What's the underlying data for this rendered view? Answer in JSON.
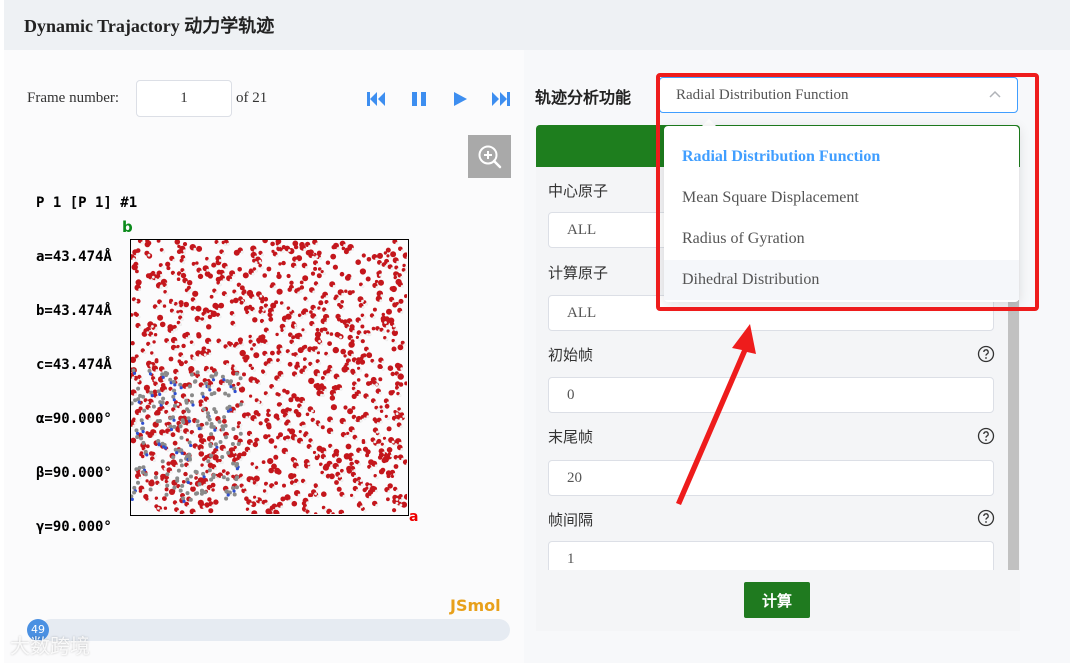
{
  "header": {
    "title": "Dynamic Trajactory 动力学轨迹"
  },
  "viewer": {
    "frame_label": "Frame number:",
    "frame_value": "1",
    "frame_of": "of 21",
    "controls": [
      "skip-back-icon",
      "pause-icon",
      "play-icon",
      "skip-forward-icon"
    ],
    "unit_cell_lines": [
      "P 1 [P 1] #1",
      "a=43.474Å",
      "b=43.474Å",
      "c=43.474Å",
      "α=90.000°",
      "β=90.000°",
      "γ=90.000°"
    ],
    "axis_a": "a",
    "axis_b": "b",
    "logo": "JSmol",
    "badge": "49",
    "watermark": "大数跨境"
  },
  "analysis": {
    "label": "轨迹分析功能",
    "selected": "Radial Distribution Function",
    "options": [
      {
        "label": "Radial Distribution Function",
        "state": "selected"
      },
      {
        "label": "Mean Square Displacement",
        "state": "normal"
      },
      {
        "label": "Radius of Gyration",
        "state": "normal"
      },
      {
        "label": "Dihedral Distribution",
        "state": "hovered"
      }
    ]
  },
  "form": {
    "center_atom_label": "中心原子",
    "center_atom_value": "ALL",
    "calc_atom_label": "计算原子",
    "calc_atom_value": "ALL",
    "start_frame_label": "初始帧",
    "start_frame_value": "0",
    "end_frame_label": "末尾帧",
    "end_frame_value": "20",
    "interval_label": "帧间隔",
    "interval_value": "1",
    "submit_label": "计算"
  },
  "colors": {
    "accent": "#409eff",
    "green": "#1e7e1e",
    "highlight": "#ee1c1c",
    "atom_red": "#c4161c"
  }
}
